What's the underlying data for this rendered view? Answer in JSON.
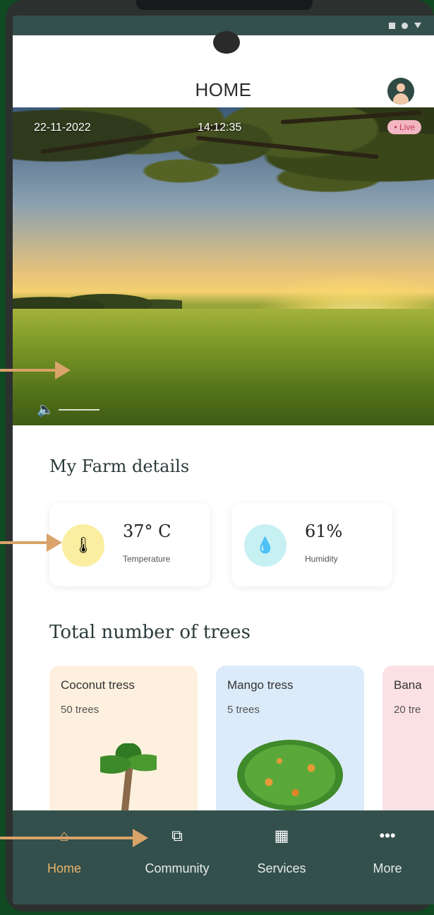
{
  "header": {
    "title": "HOME"
  },
  "hero": {
    "date": "22-11-2022",
    "time": "14:12:35",
    "live_label": "Live"
  },
  "farm": {
    "title": "My Farm details",
    "stats": [
      {
        "value": "37° C",
        "label": "Temperature",
        "icon": "thermometer-icon"
      },
      {
        "value": "61%",
        "label": "Humidity",
        "icon": "water-drop-icon"
      }
    ]
  },
  "trees": {
    "title": "Total number of trees",
    "cards": [
      {
        "name": "Coconut tress",
        "count": "50 trees",
        "color": "#fdf0de"
      },
      {
        "name": "Mango tress",
        "count": "5 trees",
        "color": "#dcebf9"
      },
      {
        "name": "Bana",
        "count": "20 tre",
        "color": "#fbe1e4"
      }
    ]
  },
  "nav": {
    "items": [
      {
        "label": "Home",
        "icon": "home-icon",
        "active": true
      },
      {
        "label": "Community",
        "icon": "community-icon",
        "active": false
      },
      {
        "label": "Services",
        "icon": "store-icon",
        "active": false
      },
      {
        "label": "More",
        "icon": "more-icon",
        "active": false
      }
    ]
  },
  "colors": {
    "background": "#0f4a22",
    "bar": "#34504c",
    "active_nav": "#e7b46b",
    "annotation_arrow": "#d9a36a"
  }
}
